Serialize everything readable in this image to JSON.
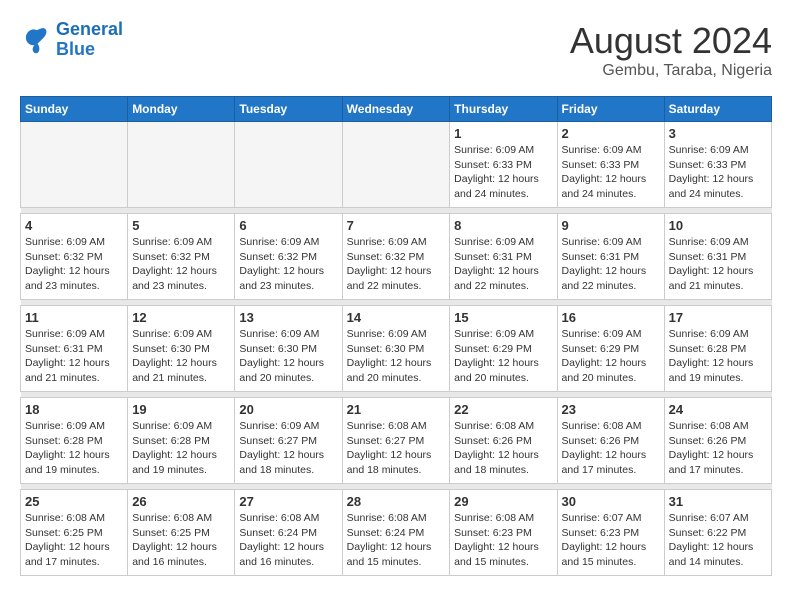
{
  "logo": {
    "text_general": "General",
    "text_blue": "Blue"
  },
  "title": "August 2024",
  "location": "Gembu, Taraba, Nigeria",
  "days_of_week": [
    "Sunday",
    "Monday",
    "Tuesday",
    "Wednesday",
    "Thursday",
    "Friday",
    "Saturday"
  ],
  "weeks": [
    [
      {
        "day": "",
        "info": ""
      },
      {
        "day": "",
        "info": ""
      },
      {
        "day": "",
        "info": ""
      },
      {
        "day": "",
        "info": ""
      },
      {
        "day": "1",
        "info": "Sunrise: 6:09 AM\nSunset: 6:33 PM\nDaylight: 12 hours\nand 24 minutes."
      },
      {
        "day": "2",
        "info": "Sunrise: 6:09 AM\nSunset: 6:33 PM\nDaylight: 12 hours\nand 24 minutes."
      },
      {
        "day": "3",
        "info": "Sunrise: 6:09 AM\nSunset: 6:33 PM\nDaylight: 12 hours\nand 24 minutes."
      }
    ],
    [
      {
        "day": "4",
        "info": "Sunrise: 6:09 AM\nSunset: 6:32 PM\nDaylight: 12 hours\nand 23 minutes."
      },
      {
        "day": "5",
        "info": "Sunrise: 6:09 AM\nSunset: 6:32 PM\nDaylight: 12 hours\nand 23 minutes."
      },
      {
        "day": "6",
        "info": "Sunrise: 6:09 AM\nSunset: 6:32 PM\nDaylight: 12 hours\nand 23 minutes."
      },
      {
        "day": "7",
        "info": "Sunrise: 6:09 AM\nSunset: 6:32 PM\nDaylight: 12 hours\nand 22 minutes."
      },
      {
        "day": "8",
        "info": "Sunrise: 6:09 AM\nSunset: 6:31 PM\nDaylight: 12 hours\nand 22 minutes."
      },
      {
        "day": "9",
        "info": "Sunrise: 6:09 AM\nSunset: 6:31 PM\nDaylight: 12 hours\nand 22 minutes."
      },
      {
        "day": "10",
        "info": "Sunrise: 6:09 AM\nSunset: 6:31 PM\nDaylight: 12 hours\nand 21 minutes."
      }
    ],
    [
      {
        "day": "11",
        "info": "Sunrise: 6:09 AM\nSunset: 6:31 PM\nDaylight: 12 hours\nand 21 minutes."
      },
      {
        "day": "12",
        "info": "Sunrise: 6:09 AM\nSunset: 6:30 PM\nDaylight: 12 hours\nand 21 minutes."
      },
      {
        "day": "13",
        "info": "Sunrise: 6:09 AM\nSunset: 6:30 PM\nDaylight: 12 hours\nand 20 minutes."
      },
      {
        "day": "14",
        "info": "Sunrise: 6:09 AM\nSunset: 6:30 PM\nDaylight: 12 hours\nand 20 minutes."
      },
      {
        "day": "15",
        "info": "Sunrise: 6:09 AM\nSunset: 6:29 PM\nDaylight: 12 hours\nand 20 minutes."
      },
      {
        "day": "16",
        "info": "Sunrise: 6:09 AM\nSunset: 6:29 PM\nDaylight: 12 hours\nand 20 minutes."
      },
      {
        "day": "17",
        "info": "Sunrise: 6:09 AM\nSunset: 6:28 PM\nDaylight: 12 hours\nand 19 minutes."
      }
    ],
    [
      {
        "day": "18",
        "info": "Sunrise: 6:09 AM\nSunset: 6:28 PM\nDaylight: 12 hours\nand 19 minutes."
      },
      {
        "day": "19",
        "info": "Sunrise: 6:09 AM\nSunset: 6:28 PM\nDaylight: 12 hours\nand 19 minutes."
      },
      {
        "day": "20",
        "info": "Sunrise: 6:09 AM\nSunset: 6:27 PM\nDaylight: 12 hours\nand 18 minutes."
      },
      {
        "day": "21",
        "info": "Sunrise: 6:08 AM\nSunset: 6:27 PM\nDaylight: 12 hours\nand 18 minutes."
      },
      {
        "day": "22",
        "info": "Sunrise: 6:08 AM\nSunset: 6:26 PM\nDaylight: 12 hours\nand 18 minutes."
      },
      {
        "day": "23",
        "info": "Sunrise: 6:08 AM\nSunset: 6:26 PM\nDaylight: 12 hours\nand 17 minutes."
      },
      {
        "day": "24",
        "info": "Sunrise: 6:08 AM\nSunset: 6:26 PM\nDaylight: 12 hours\nand 17 minutes."
      }
    ],
    [
      {
        "day": "25",
        "info": "Sunrise: 6:08 AM\nSunset: 6:25 PM\nDaylight: 12 hours\nand 17 minutes."
      },
      {
        "day": "26",
        "info": "Sunrise: 6:08 AM\nSunset: 6:25 PM\nDaylight: 12 hours\nand 16 minutes."
      },
      {
        "day": "27",
        "info": "Sunrise: 6:08 AM\nSunset: 6:24 PM\nDaylight: 12 hours\nand 16 minutes."
      },
      {
        "day": "28",
        "info": "Sunrise: 6:08 AM\nSunset: 6:24 PM\nDaylight: 12 hours\nand 15 minutes."
      },
      {
        "day": "29",
        "info": "Sunrise: 6:08 AM\nSunset: 6:23 PM\nDaylight: 12 hours\nand 15 minutes."
      },
      {
        "day": "30",
        "info": "Sunrise: 6:07 AM\nSunset: 6:23 PM\nDaylight: 12 hours\nand 15 minutes."
      },
      {
        "day": "31",
        "info": "Sunrise: 6:07 AM\nSunset: 6:22 PM\nDaylight: 12 hours\nand 14 minutes."
      }
    ]
  ]
}
